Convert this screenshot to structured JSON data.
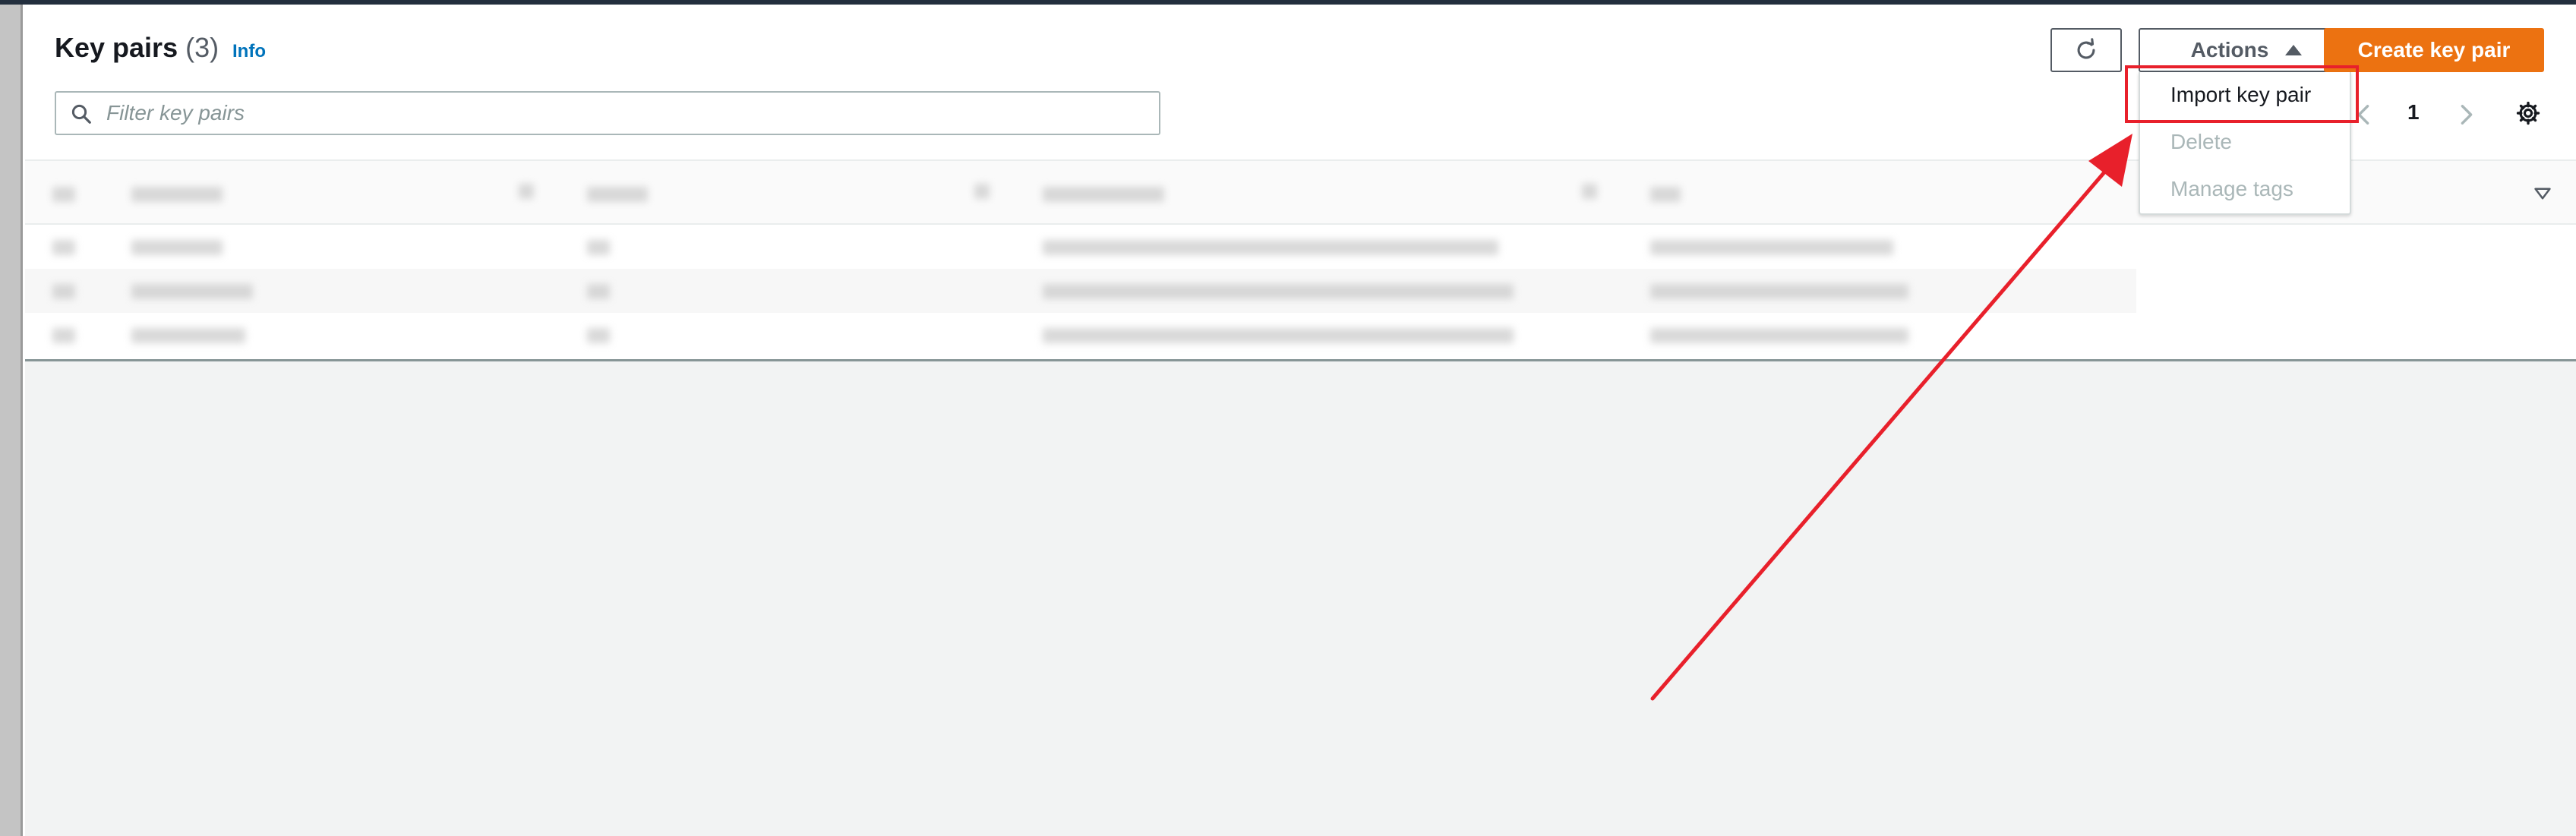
{
  "page": {
    "title": "Key pairs",
    "count": "(3)",
    "info_link": "Info"
  },
  "toolbar": {
    "refresh_icon": "refresh-icon",
    "actions_label": "Actions",
    "create_label": "Create key pair"
  },
  "filter": {
    "placeholder": "Filter key pairs",
    "value": ""
  },
  "pagination": {
    "current_page": "1"
  },
  "actions_menu": {
    "items": [
      {
        "label": "Import key pair",
        "enabled": true
      },
      {
        "label": "Delete",
        "enabled": false
      },
      {
        "label": "Manage tags",
        "enabled": false
      }
    ]
  },
  "colors": {
    "primary_button": "#ec7211",
    "link": "#0073bb",
    "annotation": "#e8202b"
  }
}
